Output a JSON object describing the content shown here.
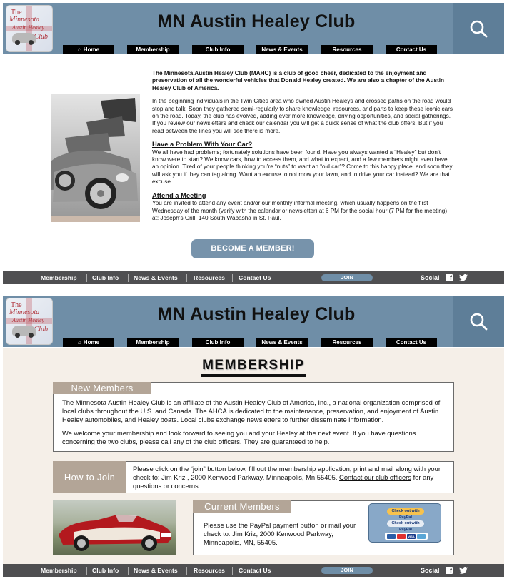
{
  "logo": {
    "line1": "The",
    "line2": "Minnesota",
    "line3": "Austin Healey",
    "line4": "Club"
  },
  "site_title": "MN Austin Healey Club",
  "nav": [
    {
      "label": "Home",
      "icon": "home-icon"
    },
    {
      "label": "Membership"
    },
    {
      "label": "Club Info"
    },
    {
      "label": "News & Events"
    },
    {
      "label": "Resources"
    },
    {
      "label": "Contact Us"
    }
  ],
  "home": {
    "lead": "The Minnesota Austin Healey Club (MAHC) is a club of good cheer, dedicated to the enjoyment and preservation of all the wonderful vehicles that Donald Healey created. We are also a chapter of the Austin Healey Club of America.",
    "para1": "In the beginning individuals in the Twin Cities area who owned Austin Healeys and crossed paths on the road would stop and talk. Soon they gathered semi-regularly to share knowledge, resources, and parts to keep these iconic cars on the road. Today, the club has evolved, adding ever more knowledge, driving opportunities, and social gatherings. If you review our newsletters and check our calendar you will get a quick sense of what the club offers. But if you read between the lines you will see there is more.",
    "problem_heading": "Have a Problem With Your Car?",
    "problem_text": "We all have had problems; fortunately solutions have been found. Have you always wanted a “Healey” but don’t know were to start? We know cars, how to access them, and what to expect, and a few members might even have an opinion. Tired of your people thinking you’re “nuts” to want an “old car”? Come to this happy place, and soon they will ask you if they can tag along. Want an excuse to not mow your lawn, and to drive your car instead? We are that excuse.",
    "meeting_heading": "Attend a Meeting",
    "meeting_text": "You are invited to attend any event and/or our monthly informal meeting, which usually happens on the first Wednesday of the month (verify with the calendar or newsletter) at 6 PM for the social hour (7 PM for the meeting) at: Joseph’s Grill, 140 South Wabasha in St. Paul.",
    "become_button": "BECOME A MEMBER!"
  },
  "footer": {
    "links": [
      "Membership",
      "Club Info",
      "News & Events",
      "Resources",
      "Contact Us"
    ],
    "join": "JOIN",
    "social": "Social"
  },
  "membership": {
    "title": "MEMBERSHIP",
    "new_members_label": "New Members",
    "new_members_p1": "The Minnesota Austin Healey Club is an affiliate of the Austin Healey Club of America, Inc., a national organization comprised of local clubs throughout the U.S. and Canada. The AHCA is dedicated to the maintenance, preservation, and enjoyment of Austin Healey automobiles, and Healey boats. Local clubs exchange newsletters to further disseminate information.",
    "new_members_p2": "We welcome your membership and look forward to seeing you and your Healey at the next event. If you have questions concerning the two clubs, please call any of the club officers. They are guaranteed to help.",
    "how_to_join_label": "How to Join",
    "how_to_join_text": "Please click on the “join” button below, fill out the membership application, print and mail along with your check to: Jim Kriz , 2000 Kenwood Parkway, Minneapolis, Mn 55405.",
    "contact_link": "Contact our club officers",
    "how_to_join_tail": "for any questions or concerns.",
    "current_members_label": "Current Members",
    "current_members_text": "Please use the PayPal payment button or mail your check to: Jim Kriz, 2000 Kenwood Parkway, Minneapolis, MN, 55405.",
    "paypal_btn1": "Check out with PayPal",
    "paypal_btn2": "Check out with PayPal",
    "cards": [
      "",
      "",
      "VISA",
      ""
    ]
  }
}
